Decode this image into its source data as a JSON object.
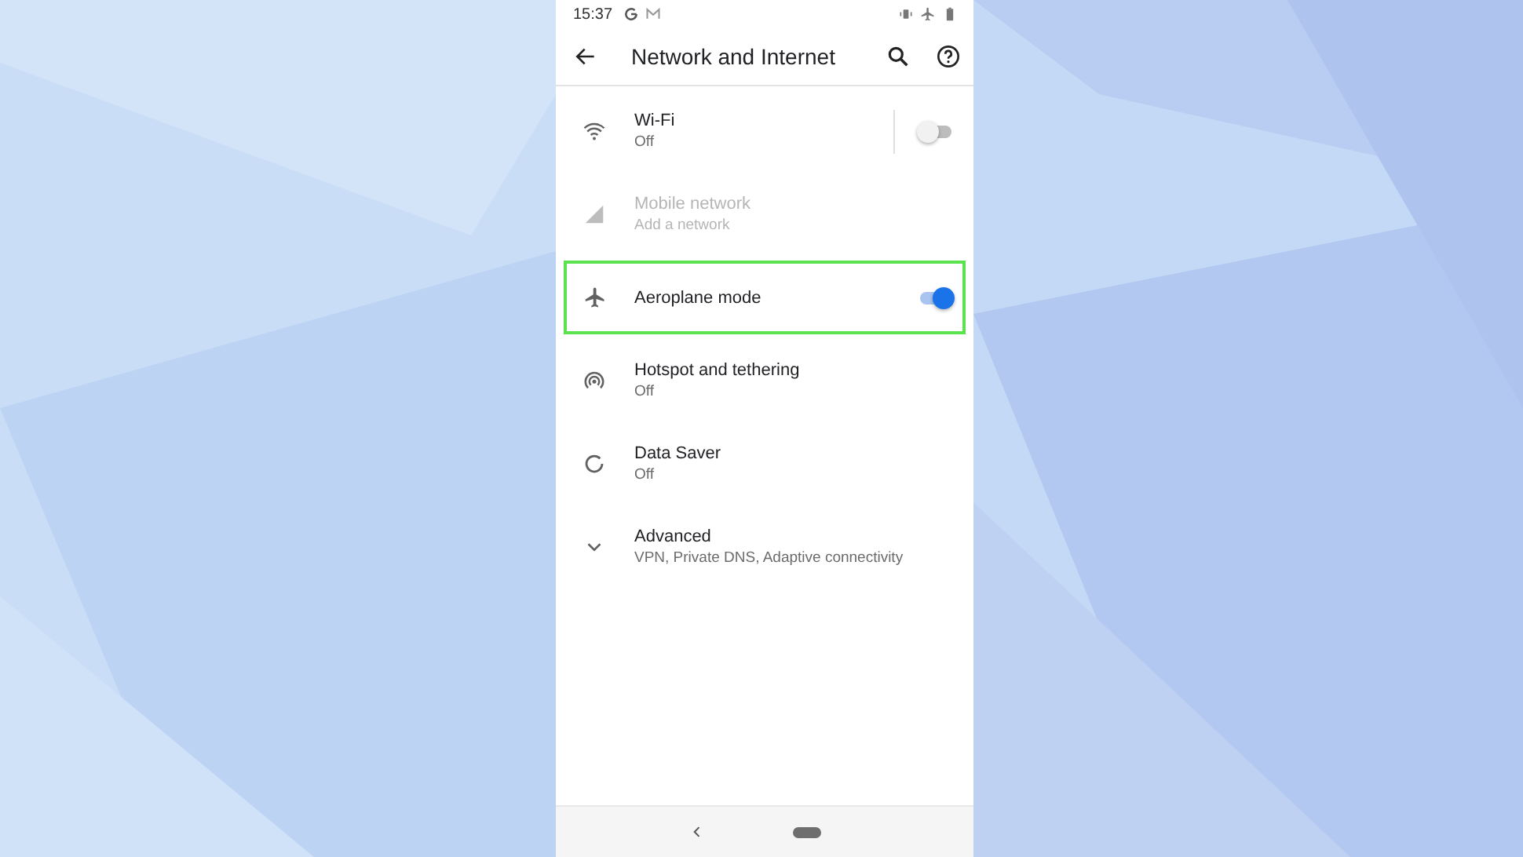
{
  "status_bar": {
    "time": "15:37"
  },
  "toolbar": {
    "title": "Network and Internet"
  },
  "items": [
    {
      "kind": "toggle",
      "title": "Wi-Fi",
      "summary": "Off",
      "on": false,
      "divider": true,
      "disabled": false,
      "highlighted": false
    },
    {
      "kind": "plain",
      "title": "Mobile network",
      "summary": "Add a network",
      "disabled": true,
      "highlighted": false
    },
    {
      "kind": "toggle",
      "title": "Aeroplane mode",
      "on": true,
      "divider": false,
      "disabled": false,
      "highlighted": true
    },
    {
      "kind": "plain",
      "title": "Hotspot and tethering",
      "summary": "Off",
      "disabled": false,
      "highlighted": false
    },
    {
      "kind": "plain",
      "title": "Data Saver",
      "summary": "Off",
      "disabled": false,
      "highlighted": false
    },
    {
      "kind": "expand",
      "title": "Advanced",
      "summary": "VPN, Private DNS, Adaptive connectivity",
      "expanded": false,
      "disabled": false,
      "highlighted": false
    }
  ]
}
